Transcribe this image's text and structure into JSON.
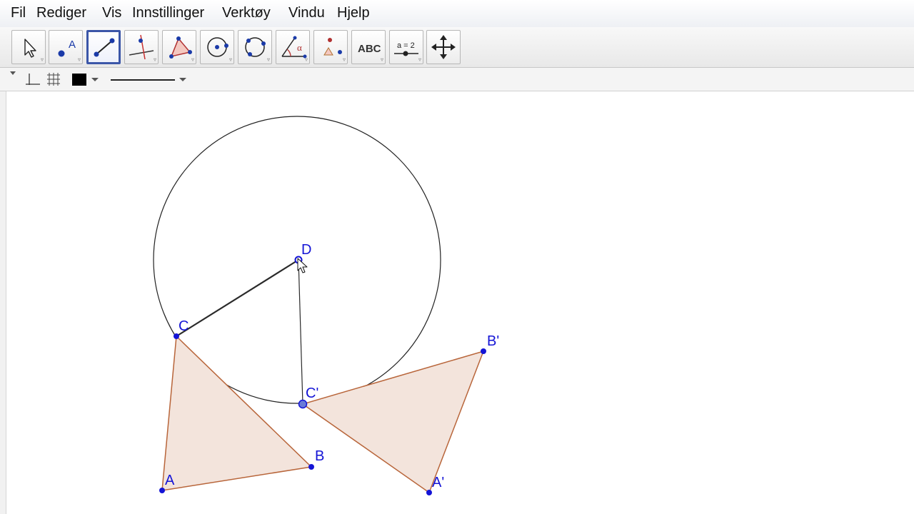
{
  "menu": [
    "Fil",
    "Rediger",
    "Vis",
    "Innstillinger",
    "Verktøy",
    "Vindu",
    "Hjelp"
  ],
  "toolbar": {
    "tools": [
      {
        "name": "move-tool",
        "icon": "cursor-arrow-icon"
      },
      {
        "name": "point-tool",
        "icon": "point-icon",
        "text": "A"
      },
      {
        "name": "segment-tool",
        "icon": "line-through-two-points-icon",
        "selected": true
      },
      {
        "name": "perpendicular-line-tool",
        "icon": "perpendicular-line-icon"
      },
      {
        "name": "polygon-tool",
        "icon": "polygon-icon"
      },
      {
        "name": "circle-center-point-tool",
        "icon": "circle-with-center-icon"
      },
      {
        "name": "circle-three-points-tool",
        "icon": "circle-three-points-icon"
      },
      {
        "name": "angle-tool",
        "icon": "angle-icon",
        "text": "α"
      },
      {
        "name": "reflect-tool",
        "icon": "reflect-about-point-icon"
      },
      {
        "name": "text-tool",
        "icon": "text-icon",
        "text": "ABC"
      },
      {
        "name": "slider-tool",
        "icon": "slider-icon",
        "text": "a = 2"
      },
      {
        "name": "move-graphics-view-tool",
        "icon": "move-view-icon"
      }
    ]
  },
  "stylebar": {
    "axes_icon": "axes-icon",
    "grid_icon": "grid-icon",
    "color": "#000000",
    "line_style": "solid"
  },
  "colors": {
    "point": "#1414d6",
    "polygon_fill": "#f3e4dc",
    "polygon_edge": "#b8653a",
    "circle": "#222222",
    "selected_tool_border": "#3b56a8"
  },
  "geometry": {
    "points": {
      "A": {
        "label": "A"
      },
      "B": {
        "label": "B"
      },
      "C": {
        "label": "C"
      },
      "D": {
        "label": "D"
      },
      "A_prime": {
        "label": "A'"
      },
      "B_prime": {
        "label": "B'"
      },
      "C_prime": {
        "label": "C'"
      }
    },
    "polygons": [
      {
        "name": "triangle-ABC",
        "vertices": [
          "A",
          "B",
          "C"
        ]
      },
      {
        "name": "triangle-A'B'C'",
        "vertices": [
          "A'",
          "B'",
          "C'"
        ]
      }
    ],
    "segments": [
      {
        "name": "segment-CD",
        "from": "C",
        "to": "D"
      },
      {
        "name": "segment-DC'",
        "from": "D",
        "to": "C'"
      }
    ],
    "circle": {
      "center": "D",
      "through": "C"
    }
  }
}
